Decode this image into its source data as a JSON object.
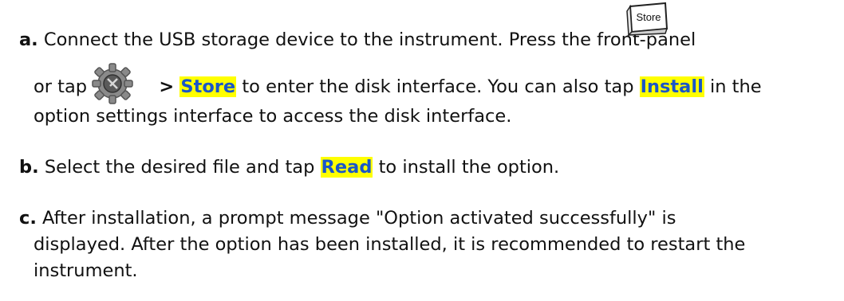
{
  "steps": [
    {
      "marker": "a.",
      "line1": "Connect the USB storage device to the instrument. Press the front-panel",
      "store_key_label": "Store",
      "line2_pre": "or tap",
      "line2_sep": ">",
      "line2_hl1": "Store",
      "line2_mid": "to enter the disk interface. You can also tap",
      "line2_hl2": "Install",
      "line2_post": "in the",
      "line3": "option settings interface to access the disk interface."
    },
    {
      "marker": "b.",
      "pre": "Select the desired file and tap",
      "hl": "Read",
      "post": "to install the option."
    },
    {
      "marker": "c.",
      "line1": "After installation, a prompt message \"Option activated successfully\" is",
      "line2": "displayed. After the option has been installed, it is recommended to restart the",
      "line3": "instrument."
    }
  ],
  "colors": {
    "highlight_bg": "#ffff00",
    "highlight_text": "#1a56c8"
  }
}
